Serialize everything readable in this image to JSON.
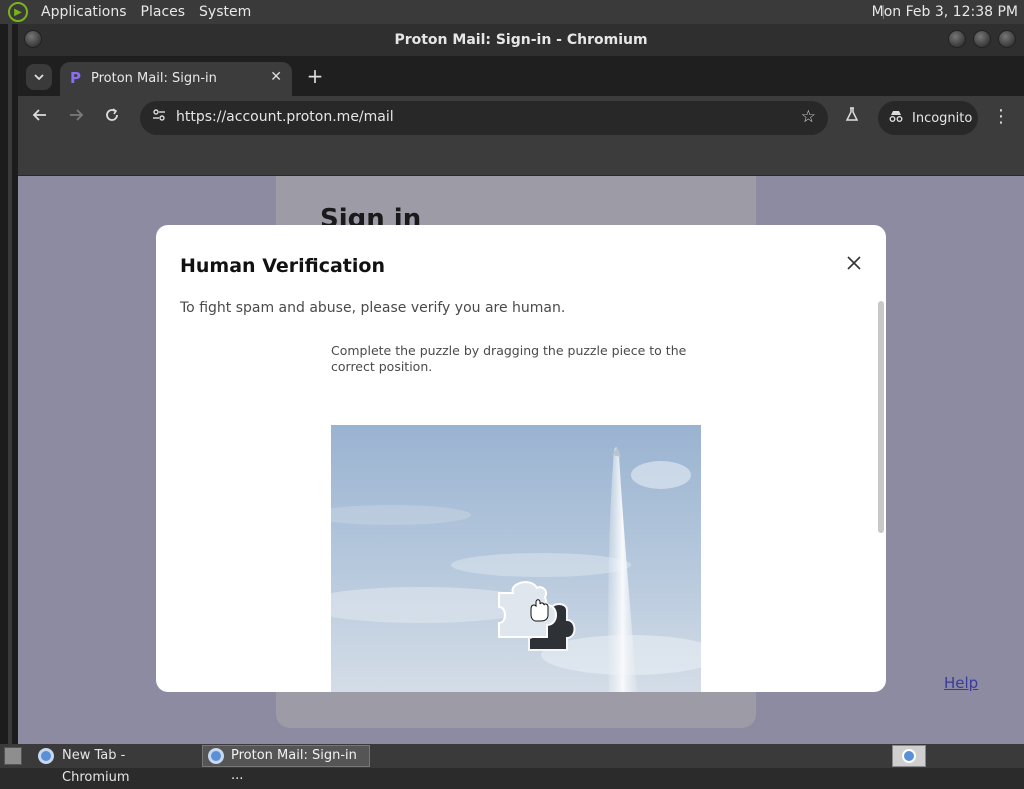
{
  "panel": {
    "menus": [
      "Applications",
      "Places",
      "System"
    ],
    "clock": "Mon Feb  3, 12:38 PM"
  },
  "window": {
    "title": "Proton Mail: Sign-in - Chromium"
  },
  "tabs": [
    {
      "title": "Proton Mail: Sign-in",
      "active": true
    }
  ],
  "toolbar": {
    "url": "https://account.proton.me/mail",
    "incognito_label": "Incognito"
  },
  "page": {
    "signin_title": "Sign in",
    "help_link": "Help"
  },
  "modal": {
    "title": "Human Verification",
    "description": "To fight spam and abuse, please verify you are human.",
    "puzzle_instruction": "Complete the puzzle by dragging the puzzle piece to the correct position."
  },
  "taskbar": {
    "items": [
      {
        "label": "New Tab - Chromium",
        "active": false
      },
      {
        "label": "Proton Mail: Sign-in ...",
        "active": true
      }
    ]
  },
  "colors": {
    "page_overlay": "#8d8ba1",
    "proton_accent": "#8b6cf2",
    "panel_bg": "#3a3a3a"
  }
}
